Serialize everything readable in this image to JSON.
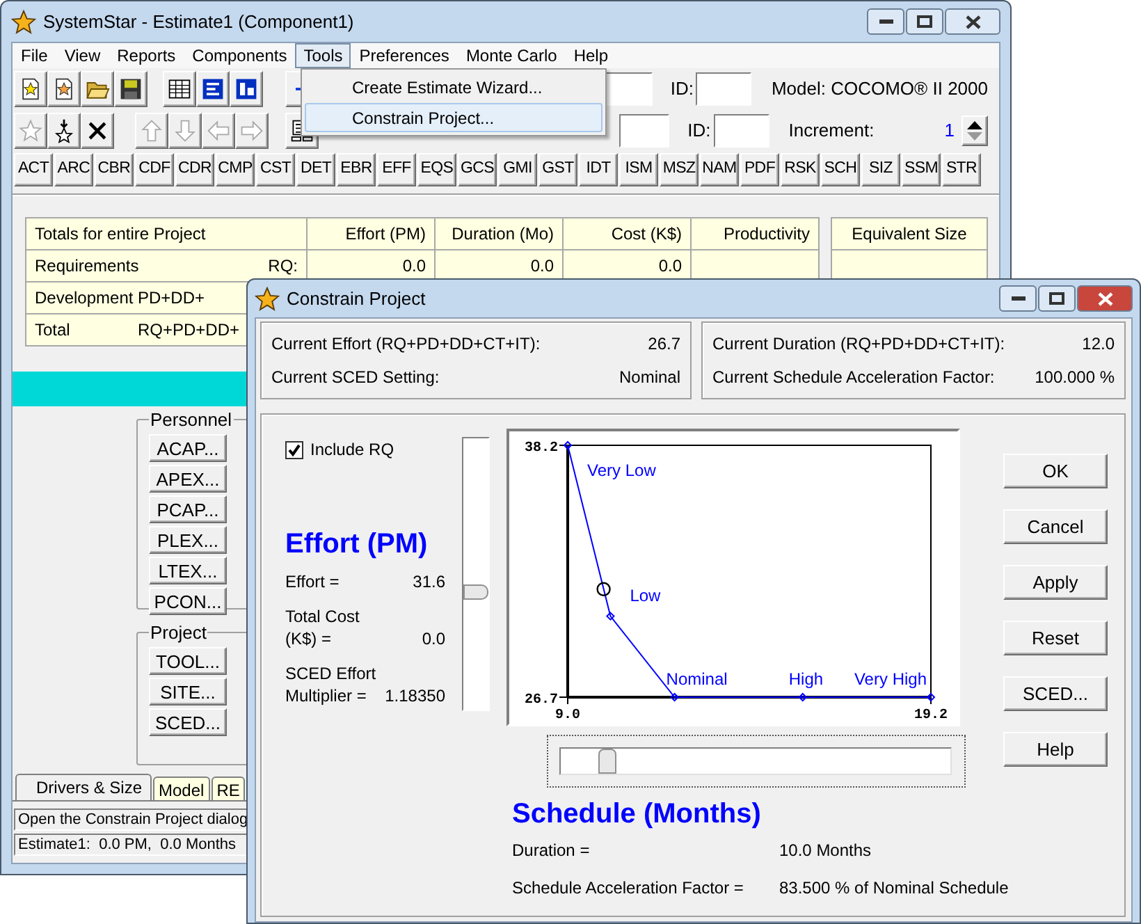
{
  "window": {
    "title": "SystemStar - Estimate1 (Component1)"
  },
  "menu": [
    {
      "label": "File",
      "selected": false
    },
    {
      "label": "View",
      "selected": false
    },
    {
      "label": "Reports",
      "selected": false
    },
    {
      "label": "Components",
      "selected": false
    },
    {
      "label": "Tools",
      "selected": true
    },
    {
      "label": "Preferences",
      "selected": false
    },
    {
      "label": "Monte Carlo",
      "selected": false
    },
    {
      "label": "Help",
      "selected": false
    }
  ],
  "tools_menu": [
    {
      "label": "Create Estimate Wizard...",
      "selected": false
    },
    {
      "label": "Constrain Project...",
      "selected": true
    }
  ],
  "toolbar_2": [
    {
      "disabled": true
    },
    {
      "disabled": false
    },
    {
      "disabled": false
    },
    {
      "disabled": true
    },
    {
      "disabled": true
    },
    {
      "disabled": true
    },
    {
      "disabled": true
    },
    {
      "disabled": false
    }
  ],
  "id_labels": [
    "ID:",
    "ID:"
  ],
  "model": "Model: COCOMO® II 2000",
  "increment": {
    "label": "Increment:",
    "value": "1"
  },
  "driver_buttons": [
    "ACT",
    "ARC",
    "CBR",
    "CDF",
    "CDR",
    "CMP",
    "CST",
    "DET",
    "EBR",
    "EFF",
    "EQS",
    "GCS",
    "GMI",
    "GST",
    "IDT",
    "ISM",
    "MSZ",
    "NAM",
    "PDF",
    "RSK",
    "SCH",
    "SIZ",
    "SSM",
    "STR"
  ],
  "totals_table": {
    "columns": [
      "Totals for entire Project",
      "Effort (PM)",
      "Duration (Mo)",
      "Cost (K$)",
      "Productivity"
    ],
    "size_column": "Equivalent Size",
    "rows": [
      {
        "label": "Requirements",
        "phases": "RQ:",
        "cells": [
          "0.0",
          "0.0",
          "0.0"
        ]
      },
      {
        "label": "Development",
        "phases": "PD+DD+"
      },
      {
        "label": "Total",
        "phases": "RQ+PD+DD+"
      }
    ]
  },
  "personnel": {
    "title": "Personnel",
    "buttons": [
      "ACAP...",
      "APEX...",
      "PCAP...",
      "PLEX...",
      "LTEX...",
      "PCON..."
    ]
  },
  "project": {
    "title": "Project",
    "buttons": [
      "TOOL...",
      "SITE...",
      "SCED..."
    ]
  },
  "tabs": [
    {
      "label": "Drivers & Size",
      "selected": true
    },
    {
      "label": "Model",
      "selected": false
    },
    {
      "label": "RE",
      "selected": false
    }
  ],
  "status_bar": [
    "Open the Constrain Project dialog",
    "Estimate1:  0.0 PM,  0.0 Months"
  ],
  "dialog": {
    "title": "Constrain Project",
    "current_left": [
      {
        "label": "Current Effort (RQ+PD+DD+CT+IT):",
        "value": "26.7"
      },
      {
        "label": "Current SCED Setting:",
        "value": "Nominal"
      }
    ],
    "current_right": [
      {
        "label": "Current Duration (RQ+PD+DD+CT+IT):",
        "value": "12.0"
      },
      {
        "label": "Current Schedule Acceleration Factor:",
        "value": "100.000 %"
      }
    ],
    "include_rq": {
      "label": "Include RQ",
      "checked": true
    },
    "effort": {
      "heading": "Effort (PM)",
      "rows": [
        {
          "label": "Effort =",
          "value": "31.6"
        },
        {
          "label": "Total Cost (K$) =",
          "value": "0.0"
        },
        {
          "label": "SCED Effort Multiplier =",
          "value": "1.18350"
        }
      ]
    },
    "effort_slider": {
      "level": 0.43
    },
    "chart_data": {
      "type": "line",
      "x": [
        9.0,
        10.2,
        12.0,
        15.6,
        19.2
      ],
      "series": [
        {
          "color": "#0000ff",
          "marker": "diamond",
          "values": [
            38.2,
            30.4,
            26.7,
            26.7,
            26.7
          ]
        }
      ],
      "xlim": [
        9.0,
        19.2
      ],
      "ylim": [
        26.7,
        38.2
      ],
      "xticks": [
        {
          "value": 9.0,
          "label": "9.0"
        },
        {
          "value": 19.2,
          "label": "19.2"
        }
      ],
      "yticks": [
        {
          "value": 26.7,
          "label": "26.7"
        },
        {
          "value": 38.2,
          "label": "38.2"
        }
      ],
      "annotations": [
        "Very Low",
        "Low",
        "Nominal",
        "High",
        "Very High"
      ]
    },
    "schedule_slider": {
      "level": 0.1
    },
    "buttons": [
      "OK",
      "Cancel",
      "Apply",
      "Reset",
      "SCED...",
      "Help"
    ],
    "schedule": {
      "heading": "Schedule (Months)",
      "rows": [
        {
          "label": "Duration =",
          "value": "10.0 Months"
        },
        {
          "label": "Schedule Acceleration Factor =",
          "value": "83.500 % of Nominal Schedule"
        }
      ]
    }
  }
}
